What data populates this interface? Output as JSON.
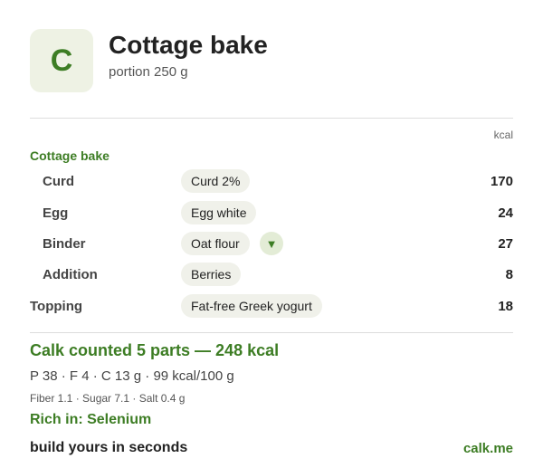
{
  "header": {
    "logo_letter": "C",
    "title": "Cottage bake",
    "subtitle": "portion 250 g"
  },
  "table": {
    "unit": "kcal",
    "section_label": "Cottage bake",
    "rows": [
      {
        "label": "Curd",
        "ingredient": "Curd 2%",
        "kcal": "170"
      },
      {
        "label": "Egg",
        "ingredient": "Egg white",
        "kcal": "24"
      },
      {
        "label": "Binder",
        "ingredient": "Oat flour",
        "kcal": "27",
        "swap_icon": "triangle-down-icon"
      },
      {
        "label": "Addition",
        "ingredient": "Berries",
        "kcal": "8"
      },
      {
        "label": "Topping",
        "ingredient": "Fat-free Greek yogurt",
        "kcal": "18"
      }
    ]
  },
  "summary": {
    "headline": "Calk counted 5 parts — 248 kcal",
    "macros": "P 38 · F 4 · C 13 g   ·   99 kcal/100 g",
    "micros": "Fiber 1.1 · Sugar 7.1 · Salt 0.4 g",
    "rich_in": "Rich in: Selenium"
  },
  "footer": {
    "tagline": "build yours in seconds",
    "brand": "calk.me"
  },
  "colors": {
    "accent": "#3d7d24",
    "chip_bg": "#f0f1ea",
    "logo_bg": "#eef2e4"
  }
}
